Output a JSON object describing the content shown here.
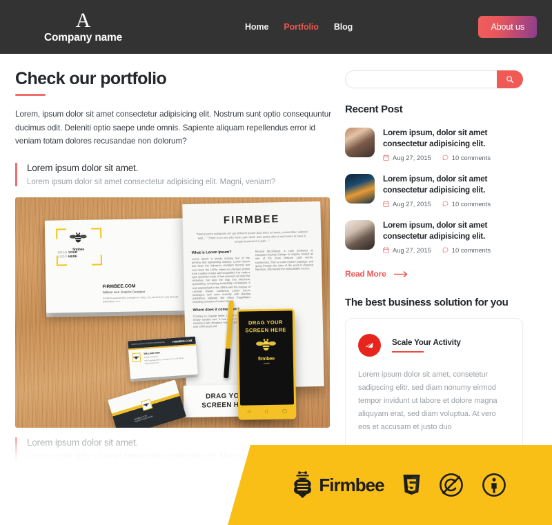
{
  "header": {
    "brand_mark": "A",
    "brand_name": "Company name",
    "nav": [
      {
        "label": "Home",
        "active": false
      },
      {
        "label": "Portfolio",
        "active": true
      },
      {
        "label": "Blog",
        "active": false
      }
    ],
    "cta_label": "About us",
    "background_color": "#333333",
    "accent_color": "#e8564f"
  },
  "main": {
    "title": "Check our portfolio",
    "lead": "Lorem, ipsum dolor sit amet consectetur adipisicing elit. Nostrum sunt optio consequuntur ducimus odit. Deleniti optio saepe unde omnis. Sapiente aliquam repellendus error id veniam totam dolores recusandae non dolorum?",
    "quote": {
      "title": "Lorem ipsum dolor sit amet.",
      "subtitle": "Lorem ipsum dolor sit amet consectetur adipisicing elit. Magni, veniam?"
    },
    "quote_faded": {
      "title": "Lorem ipsum dolor sit amet.",
      "subtitle": "Lorem ipsum dolor sit amet consectetur adipisicing elit. Magni, veniam?"
    },
    "photo": {
      "envelope": {
        "drag_line1_light": "DRAG",
        "drag_line1_bold": "YOUR",
        "drag_line2_light": "LOGO",
        "drag_line2_bold": "HERE",
        "logo_text": "firmbee",
        "site": "FIRMBEE.COM",
        "person": "William Iven Graphic Designer",
        "address": "(A) 356 Dosselsted Blvd. Carlingten KY 34021  (T) 1234 5678   (F) 1234 5678   (M) william@iven.com"
      },
      "document": {
        "title": "FIRMBEE",
        "quote": "\"Neque porro quisquam est qui dolorem ipsum quia dolor sit amet, consectetur, adipisci velit...\" \"There is no one who loves pain itself, who seeks after it and wants to have it, simply because it is pain...\"",
        "h1": "What is Lorem Ipsum?",
        "p1": "Lorem Ipsum is simply dummy text of the printing and typesetting industry. Lorem Ipsum has been the industry's standard dummy text ever since the 1500s, when an unknown printer took a galley of type and scrambled it to make a type specimen book. It has survived not only five centuries, but also the leap into electronic typesetting, remaining essentially unchanged. It was popularised in the 1960s with the release of Letraset sheets containing Lorem Ipsum passages, and more recently with desktop publishing software like Aldus PageMaker including versions of Lorem Ipsum.",
        "h2": "Where does it come from?",
        "p2": "Contrary to popular belief, Lorem Ipsum is not simply random text. It has roots in a piece of classical Latin literature from 45 BC, making it over 2000 years old.",
        "p3": "Richard McClintock, a Latin professor at Hampden-Sydney College in Virginia, looked up one of the more obscure Latin words, consectetur, from a Lorem Ipsum passage, and going through the cites of the word in classical literature, discovered the undoubtable source."
      },
      "phone": {
        "drag_text": "DRAG YOUR SCREEN HERE",
        "logo_name": "firmbee",
        "logo_domain": ".com"
      },
      "sign": {
        "line1": "DRAG YOUR",
        "line2": "SCREEN HERE"
      },
      "business_card": {
        "site": "FIRMBEE.COM",
        "top_note": "PROFESSIONAL BUSINESS BRANDING",
        "name": "WILLIAM IVEN",
        "role": "Graphic Designer",
        "details": "356 Dosselsted Blvd., Carlington KY  |  1234 5678  |  william@iven.com"
      },
      "card_back": {
        "site": "FIRMBEE.COM",
        "sub": "Graphic Design Studio"
      }
    }
  },
  "sidebar": {
    "search": {
      "value": "",
      "placeholder": ""
    },
    "recent_post_heading": "Recent Post",
    "posts": [
      {
        "title": "Lorem ipsum, dolor sit amet consectetur adipisicing elit.",
        "date": "Aug 27, 2015",
        "comments": "10 comments",
        "thumb": "woman-writing-photo"
      },
      {
        "title": "Lorem ipsum, dolor sit amet consectetur adipisicing elit.",
        "date": "Aug 27, 2015",
        "comments": "10 comments",
        "thumb": "city-night-photo"
      },
      {
        "title": "Lorem ipsum, dolor sit amet consectetur adipisicing elit.",
        "date": "Aug 27, 2015",
        "comments": "10 comments",
        "thumb": "desk-workspace-photo"
      }
    ],
    "read_more": "Read More",
    "solution_heading": "The best business solution for you",
    "solution_card": {
      "icon": "megaphone-icon",
      "title": "Scale Your Activity",
      "text": "Lorem ipsum dolor sit amet, consetetur sadipscing elitr, sed diam nonumy eirmod tempor invidunt ut labore et dolore magna aliquyam erat, sed diam voluptua. At vero eos et accusam et justo duo"
    }
  },
  "banner": {
    "background_color": "#f9bf16",
    "brand_text": "Firmbee",
    "icons": [
      "firmbee-bee-icon",
      "html5-icon",
      "no-copyright-icon",
      "attribution-icon"
    ],
    "html5_label": "HTML"
  }
}
